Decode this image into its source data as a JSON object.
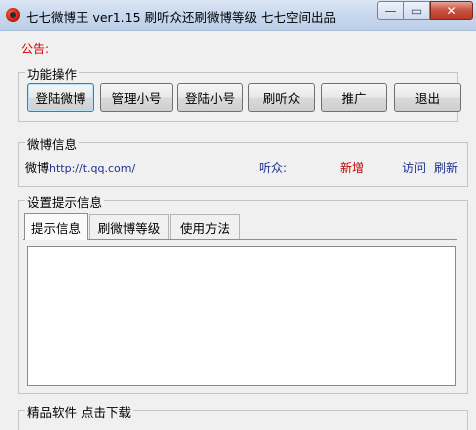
{
  "window": {
    "title": "七七微博王 ver1.15 刷听众还刷微博等级 七七空间出品",
    "minimize_glyph": "—",
    "maximize_glyph": "▭",
    "close_glyph": "✕"
  },
  "notice": {
    "label": "公告:"
  },
  "operations": {
    "title": "功能操作",
    "buttons": [
      "登陆微博",
      "管理小号",
      "登陆小号",
      "刷听众",
      "推广",
      "退出"
    ]
  },
  "weibo_info": {
    "title": "微博信息",
    "weibo_label": "微博",
    "weibo_url": "http://t.qq.com/",
    "listeners_label": "听众:",
    "new_label": "新增",
    "visit_label": "访问",
    "refresh_label": "刷新"
  },
  "settings": {
    "title": "设置提示信息",
    "tabs": [
      "提示信息",
      "刷微博等级",
      "使用方法"
    ],
    "active_tab": "提示信息",
    "tip_text": ""
  },
  "downloads": {
    "title": "精品软件 点击下载"
  },
  "colors": {
    "notice_red": "#d40000",
    "new_red": "#c00000",
    "link_blue": "#1f2f8f"
  }
}
